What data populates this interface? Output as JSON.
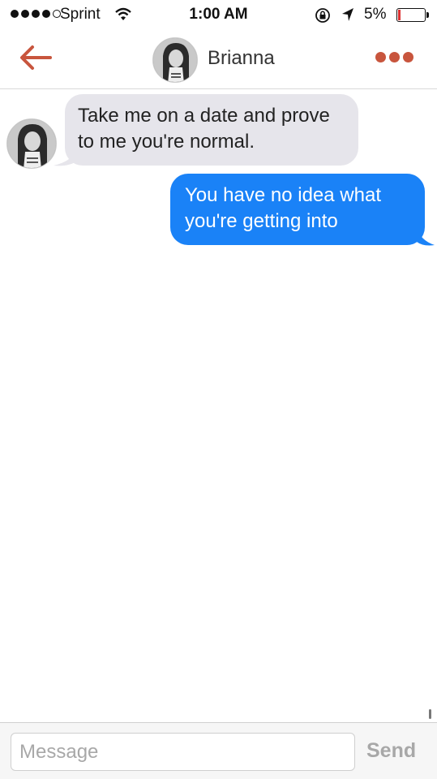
{
  "status_bar": {
    "carrier": "Sprint",
    "time": "1:00 AM",
    "battery_text": "5%",
    "battery_level": 0.05,
    "signal_bars_filled": 4,
    "signal_bars_total": 5,
    "icons": [
      "wifi-icon",
      "rotation-lock-icon",
      "location-arrow-icon",
      "battery-icon"
    ]
  },
  "header": {
    "name": "Brianna",
    "back_icon": "back-arrow-icon",
    "more_icon": "more-dots-icon",
    "accent_color": "#c8553d"
  },
  "messages": [
    {
      "direction": "incoming",
      "text": "Take me on a date and prove to me you're normal."
    },
    {
      "direction": "outgoing",
      "text": "You have no idea what you're getting into"
    }
  ],
  "colors": {
    "incoming_bubble": "#e6e5eb",
    "outgoing_bubble": "#1a82f7"
  },
  "composer": {
    "placeholder": "Message",
    "value": "",
    "send_label": "Send"
  }
}
